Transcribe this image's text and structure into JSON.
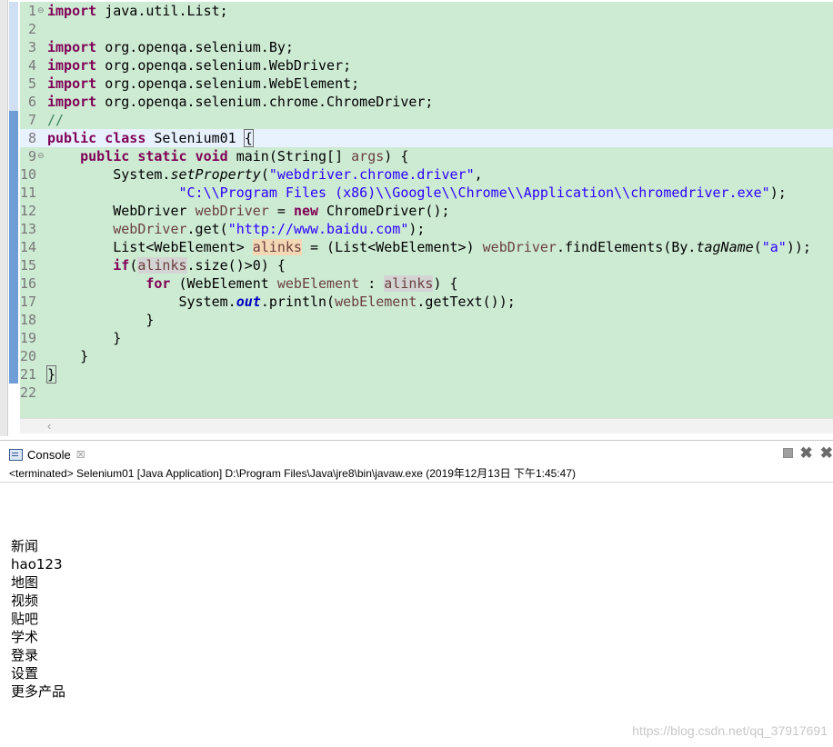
{
  "editor": {
    "lines": [
      {
        "n": "1",
        "fold": "⊖",
        "segs": [
          {
            "c": "kw",
            "t": "import"
          },
          {
            "t": " java.util.List;"
          }
        ]
      },
      {
        "n": "2",
        "segs": []
      },
      {
        "n": "3",
        "segs": [
          {
            "c": "kw",
            "t": "import"
          },
          {
            "t": " org.openqa.selenium.By;"
          }
        ]
      },
      {
        "n": "4",
        "segs": [
          {
            "c": "kw",
            "t": "import"
          },
          {
            "t": " org.openqa.selenium.WebDriver;"
          }
        ]
      },
      {
        "n": "5",
        "segs": [
          {
            "c": "kw",
            "t": "import"
          },
          {
            "t": " org.openqa.selenium.WebElement;"
          }
        ]
      },
      {
        "n": "6",
        "segs": [
          {
            "c": "kw",
            "t": "import"
          },
          {
            "t": " org.openqa.selenium.chrome.ChromeDriver;"
          }
        ]
      },
      {
        "n": "7",
        "segs": [
          {
            "c": "cmt",
            "t": "//"
          }
        ]
      },
      {
        "n": "8",
        "current": true,
        "segs": [
          {
            "c": "kw",
            "t": "public"
          },
          {
            "t": " "
          },
          {
            "c": "kw",
            "t": "class"
          },
          {
            "t": " Selenium01 "
          },
          {
            "c": "cursor-box",
            "t": "{"
          }
        ]
      },
      {
        "n": "9",
        "fold": "⊖",
        "segs": [
          {
            "t": "    "
          },
          {
            "c": "kw",
            "t": "public"
          },
          {
            "t": " "
          },
          {
            "c": "kw",
            "t": "static"
          },
          {
            "t": " "
          },
          {
            "c": "kw",
            "t": "void"
          },
          {
            "t": " main(String[] "
          },
          {
            "c": "var",
            "t": "args"
          },
          {
            "t": ") {"
          }
        ]
      },
      {
        "n": "10",
        "segs": [
          {
            "t": "        System."
          },
          {
            "c": "it",
            "t": "setProperty"
          },
          {
            "t": "("
          },
          {
            "c": "str",
            "t": "\"webdriver.chrome.driver\""
          },
          {
            "t": ","
          }
        ]
      },
      {
        "n": "11",
        "segs": [
          {
            "t": "                "
          },
          {
            "c": "str",
            "t": "\"C:\\\\Program Files (x86)\\\\Google\\\\Chrome\\\\Application\\\\chromedriver.exe\""
          },
          {
            "t": ");"
          }
        ]
      },
      {
        "n": "12",
        "segs": [
          {
            "t": "        WebDriver "
          },
          {
            "c": "var",
            "t": "webDriver"
          },
          {
            "t": " = "
          },
          {
            "c": "kw",
            "t": "new"
          },
          {
            "t": " ChromeDriver();"
          }
        ]
      },
      {
        "n": "13",
        "segs": [
          {
            "t": "        "
          },
          {
            "c": "var",
            "t": "webDriver"
          },
          {
            "t": ".get("
          },
          {
            "c": "str",
            "t": "\"http://www.baidu.com\""
          },
          {
            "t": ");"
          }
        ]
      },
      {
        "n": "14",
        "segs": [
          {
            "t": "        List<WebElement> "
          },
          {
            "c": "var occ",
            "t": "alinks"
          },
          {
            "t": " = (List<WebElement>) "
          },
          {
            "c": "var",
            "t": "webDriver"
          },
          {
            "t": ".findElements(By."
          },
          {
            "c": "it",
            "t": "tagName"
          },
          {
            "t": "("
          },
          {
            "c": "str",
            "t": "\"a\""
          },
          {
            "t": "));"
          }
        ]
      },
      {
        "n": "15",
        "segs": [
          {
            "t": "        "
          },
          {
            "c": "kw",
            "t": "if"
          },
          {
            "t": "("
          },
          {
            "c": "var occ2",
            "t": "alinks"
          },
          {
            "t": ".size()>0) {"
          }
        ]
      },
      {
        "n": "16",
        "segs": [
          {
            "t": "            "
          },
          {
            "c": "kw",
            "t": "for"
          },
          {
            "t": " (WebElement "
          },
          {
            "c": "var",
            "t": "webElement"
          },
          {
            "t": " : "
          },
          {
            "c": "var occ2",
            "t": "alinks"
          },
          {
            "t": ") {"
          }
        ]
      },
      {
        "n": "17",
        "segs": [
          {
            "t": "                System."
          },
          {
            "c": "field",
            "t": "out"
          },
          {
            "t": ".println("
          },
          {
            "c": "var",
            "t": "webElement"
          },
          {
            "t": ".getText());"
          }
        ]
      },
      {
        "n": "18",
        "segs": [
          {
            "t": "            }"
          }
        ]
      },
      {
        "n": "19",
        "segs": [
          {
            "t": "        }"
          }
        ]
      },
      {
        "n": "20",
        "segs": [
          {
            "t": "    }"
          }
        ]
      },
      {
        "n": "21",
        "segs": [
          {
            "c": "cursor-box",
            "t": "}"
          }
        ]
      },
      {
        "n": "22",
        "segs": []
      }
    ]
  },
  "console": {
    "tab_label": "Console",
    "tab_close": "☒",
    "status": "<terminated> Selenium01 [Java Application] D:\\Program Files\\Java\\jre8\\bin\\javaw.exe (2019年12月13日 下午1:45:47)",
    "output": [
      "新闻",
      "hao123",
      "地图",
      "视频",
      "贴吧",
      "学术",
      "登录",
      "设置",
      "更多产品"
    ]
  },
  "watermark": "https://blog.csdn.net/qq_37917691",
  "colors": {
    "editor_bg": "#cdebd3",
    "keyword": "#7f0055",
    "string": "#2a00ff",
    "variable": "#6a3e3e",
    "comment": "#3f7f5f"
  }
}
